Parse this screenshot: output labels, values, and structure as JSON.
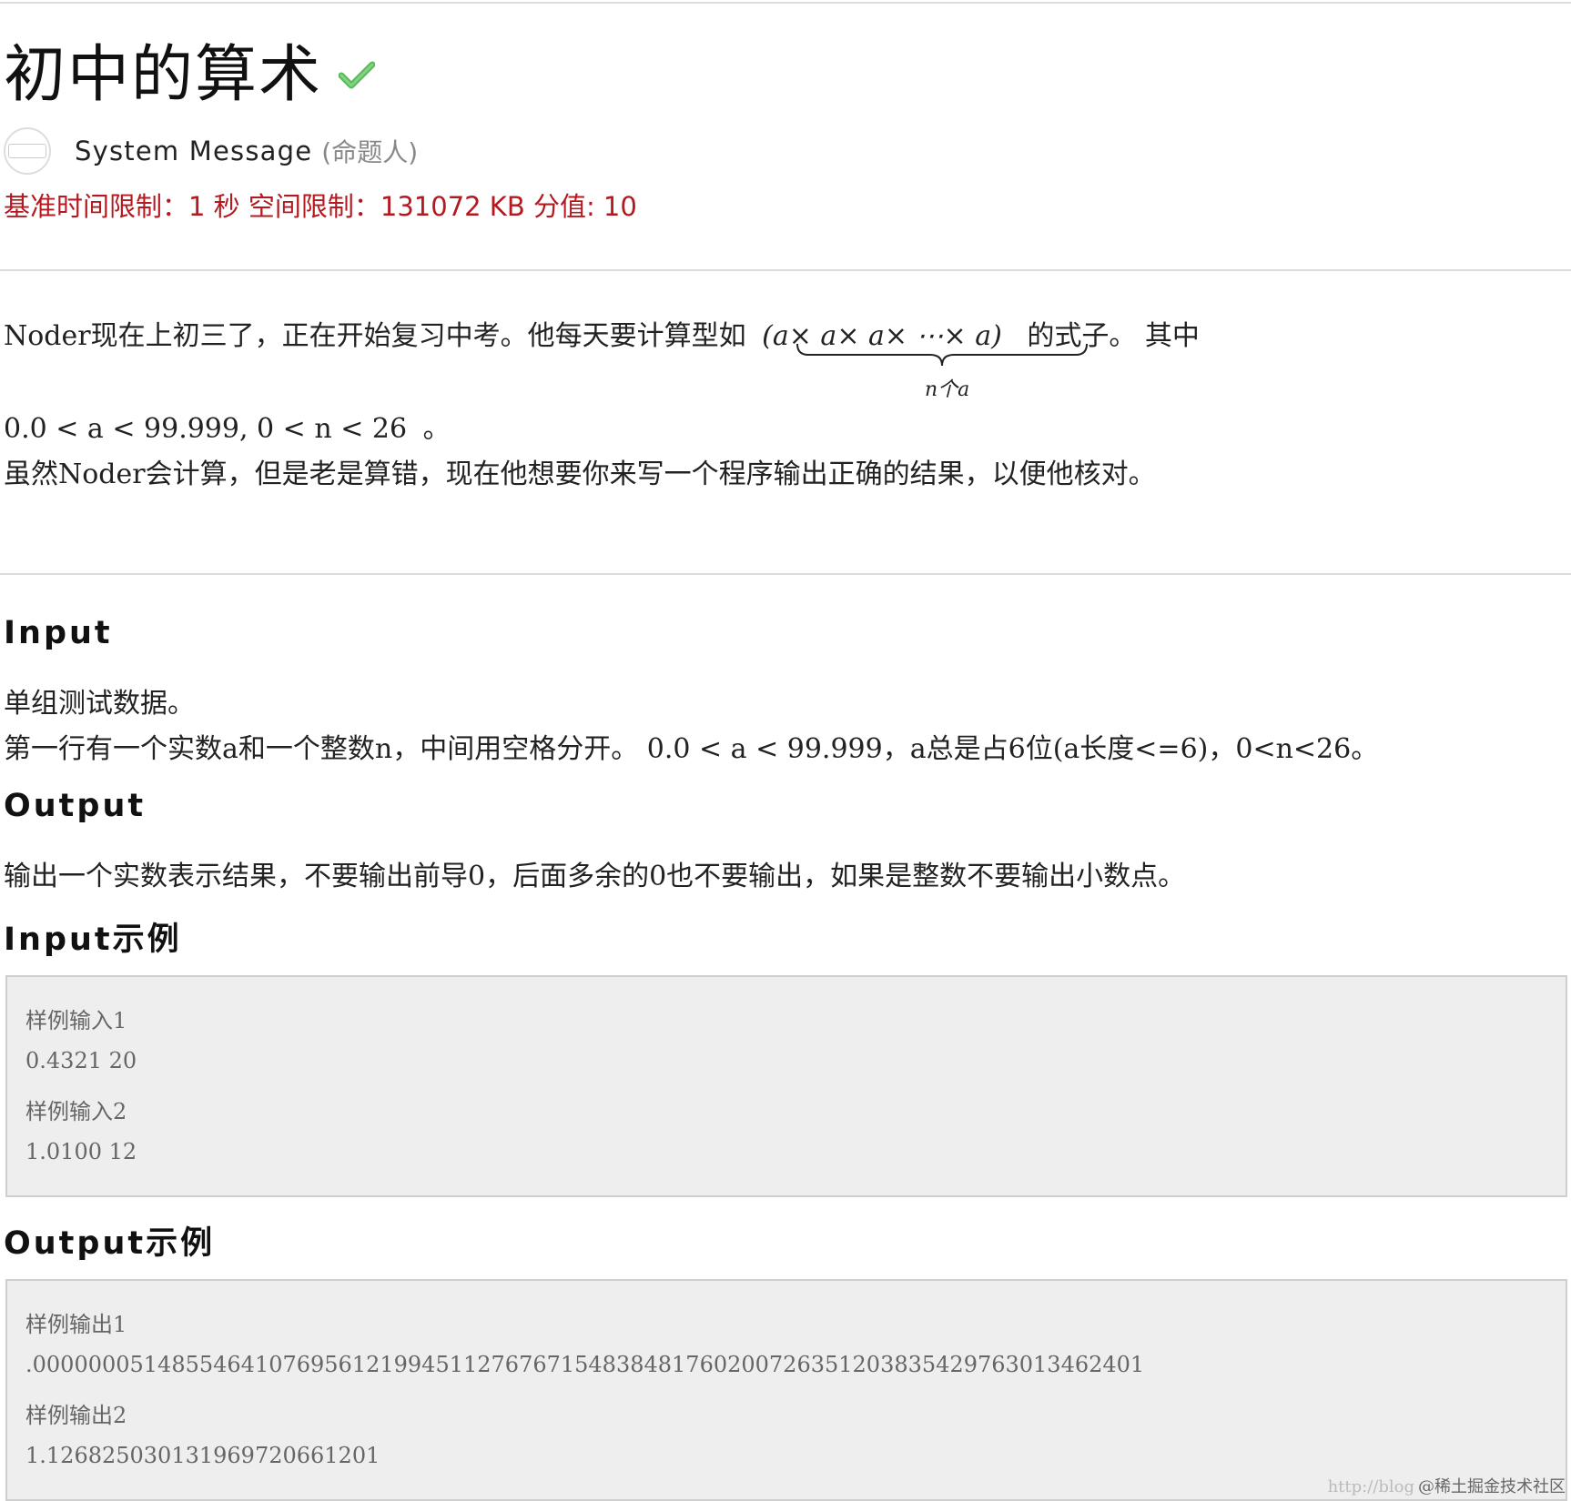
{
  "problem": {
    "title": "初中的算术",
    "author_name": "System Message",
    "author_role": "(命题人)",
    "limits": "基准时间限制：1 秒 空间限制：131072 KB 分值: 10"
  },
  "description": {
    "line1_text": "Noder现在上初三了，正在开始复习中考。他每天要计算型如",
    "formula": "(a× a× a×  ⋯× a)",
    "brace_label": "n个a",
    "line1_suffix": "的式子。 其中",
    "constraint": "0.0 < a < 99.999, 0 < n < 26",
    "constraint_end": "。",
    "line3": "虽然Noder会计算，但是老是算错，现在他想要你来写一个程序输出正确的结果，以便他核对。"
  },
  "sections": {
    "input_heading": "Input",
    "input_line1": "单组测试数据。",
    "input_line2": "第一行有一个实数a和一个整数n，中间用空格分开。 0.0 < a < 99.999，a总是占6位(a长度<=6)，0<n<26。",
    "output_heading": "Output",
    "output_line1": "输出一个实数表示结果，不要输出前导0，后面多余的0也不要输出，如果是整数不要输出小数点。",
    "input_example_heading": "Input示例",
    "output_example_heading": "Output示例"
  },
  "samples": {
    "input": [
      "样例输入1",
      "0.4321 20",
      "样例输入2",
      "1.0100 12"
    ],
    "output": [
      "样例输出1",
      ".00000005148554641076956121994511276767154838481760200726351203835429763013462401",
      "样例输出2",
      "1.126825030131969720661201"
    ]
  },
  "watermark": {
    "url": "http://blog",
    "brand": "@稀土掘金技术社区"
  }
}
